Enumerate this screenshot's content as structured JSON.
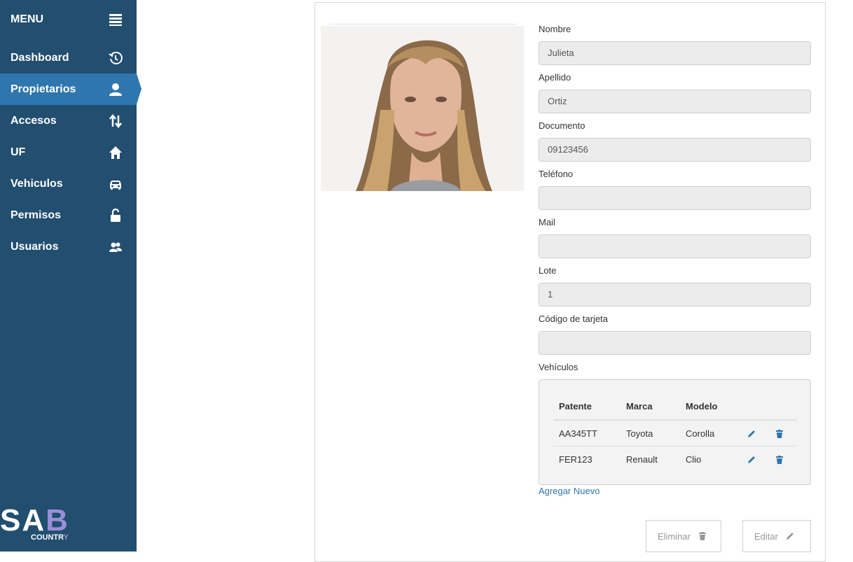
{
  "sidebar": {
    "menu_title": "MENU",
    "items": [
      {
        "label": "Dashboard",
        "icon": "history-icon",
        "active": false
      },
      {
        "label": "Propietarios",
        "icon": "user-icon",
        "active": true
      },
      {
        "label": "Accesos",
        "icon": "sort-arrows-icon",
        "active": false
      },
      {
        "label": "UF",
        "icon": "home-icon",
        "active": false
      },
      {
        "label": "Vehiculos",
        "icon": "car-icon",
        "active": false
      },
      {
        "label": "Permisos",
        "icon": "unlock-icon",
        "active": false
      },
      {
        "label": "Usuarios",
        "icon": "users-icon",
        "active": false
      }
    ],
    "logo": {
      "letters": "SA",
      "letter_b": "B",
      "sub": "COUNTR",
      "sub_y": "Y"
    }
  },
  "form": {
    "nombre": {
      "label": "Nombre",
      "value": "Julieta"
    },
    "apellido": {
      "label": "Apellido",
      "value": "Ortiz"
    },
    "documento": {
      "label": "Documento",
      "value": "09123456"
    },
    "telefono": {
      "label": "Teléfono",
      "value": ""
    },
    "mail": {
      "label": "Mail",
      "value": ""
    },
    "lote": {
      "label": "Lote",
      "value": "1"
    },
    "codigo": {
      "label": "Código de tarjeta",
      "value": ""
    }
  },
  "vehicles": {
    "label": "Vehículos",
    "headers": [
      "Patente",
      "Marca",
      "Modelo"
    ],
    "rows": [
      {
        "patente": "AA345TT",
        "marca": "Toyota",
        "modelo": "Corolla"
      },
      {
        "patente": "FER123",
        "marca": "Renault",
        "modelo": "Clio"
      }
    ],
    "add_label": "Agregar Nuevo"
  },
  "actions": {
    "delete_label": "Eliminar",
    "edit_label": "Editar"
  },
  "colors": {
    "sidebar_bg": "#224e70",
    "sidebar_active": "#2e76ad",
    "link": "#2e76ad",
    "input_bg": "#ececec"
  }
}
